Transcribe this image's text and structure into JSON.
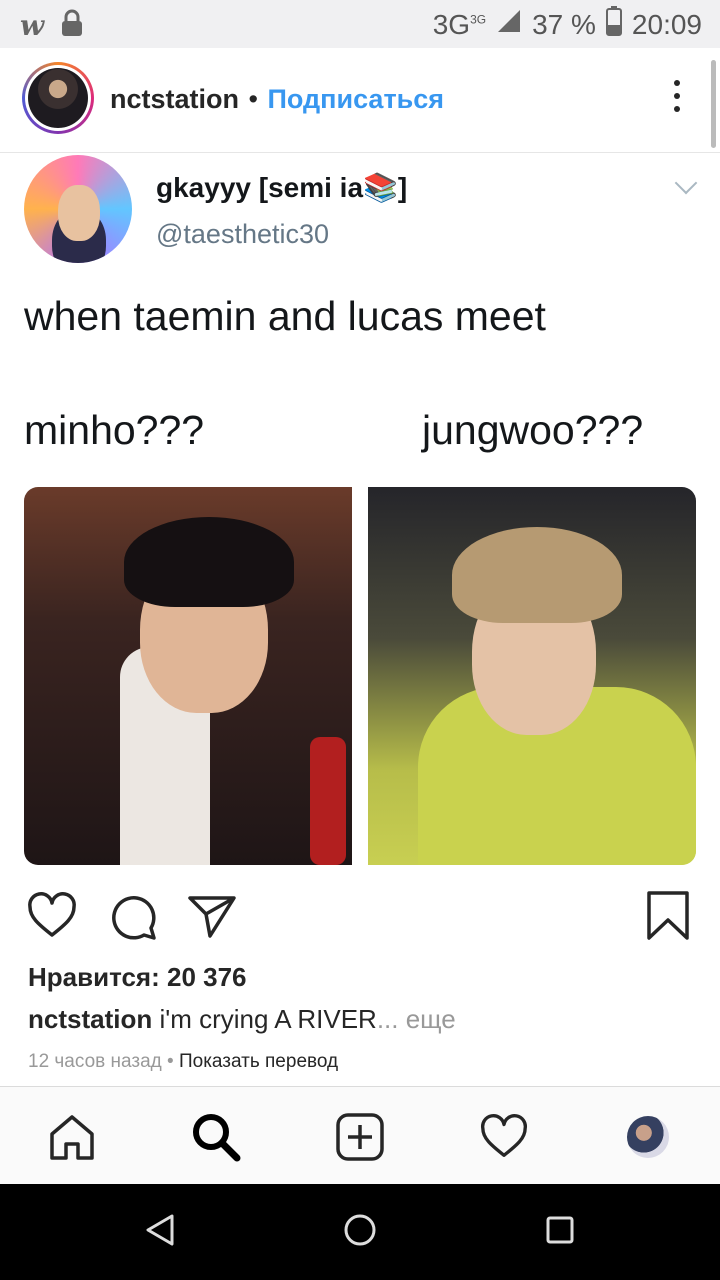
{
  "status_bar": {
    "network": "3G",
    "network_sup": "3G",
    "battery": "37 %",
    "time": "20:09"
  },
  "post_header": {
    "username": "nctstation",
    "separator": "•",
    "follow_label": "Подписаться"
  },
  "tweet": {
    "display_name": "gkayyy [semi ia📚]",
    "handle": "@taesthetic30",
    "text": "when taemin and lucas meet",
    "left_label": "minho???",
    "right_label": "jungwoo???"
  },
  "post": {
    "likes": "Нравится: 20 376",
    "caption_user": "nctstation",
    "caption_text": " i'm crying A RIVER",
    "caption_more": "... еще",
    "time_ago": "12 часов назад",
    "meta_separator": " • ",
    "translate_label": "Показать перевод"
  },
  "icons": {
    "like": "heart-icon",
    "comment": "comment-icon",
    "share": "send-icon",
    "save": "bookmark-icon"
  },
  "colors": {
    "follow": "#3897f0",
    "text": "#262626",
    "muted": "#999999"
  }
}
